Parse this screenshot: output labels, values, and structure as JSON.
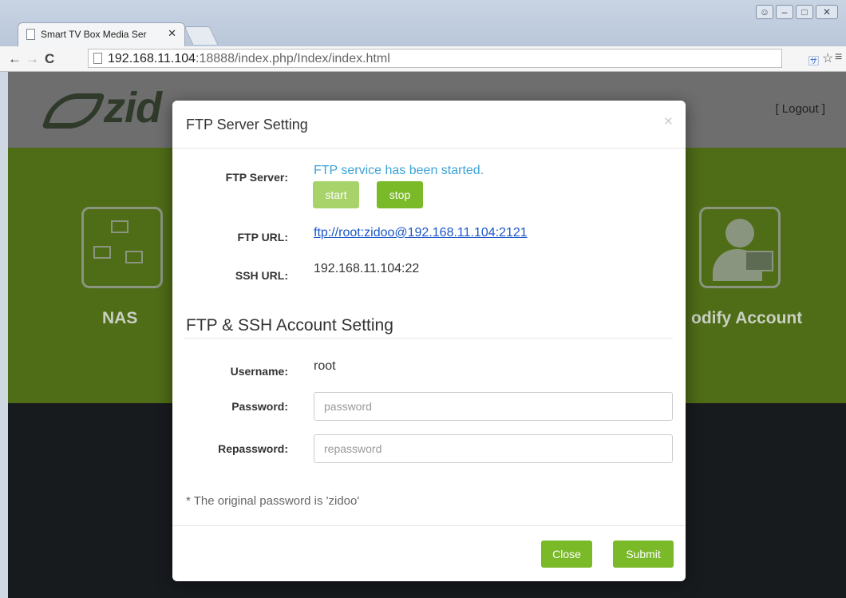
{
  "browser": {
    "tab_title": "Smart TV Box Media Ser",
    "url_host": "192.168.11.104",
    "url_rest": ":18888/index.php/Index/index.html"
  },
  "page": {
    "logo_text": "zid",
    "logout_label": "[ Logout ]",
    "tiles": [
      {
        "label": "NAS"
      },
      {
        "label": "odify Account"
      }
    ]
  },
  "modal": {
    "title": "FTP Server Setting",
    "close_glyph": "×",
    "ftp_server_label": "FTP Server:",
    "ftp_server_status": "FTP service has been started.",
    "start_label": "start",
    "stop_label": "stop",
    "ftp_url_label": "FTP URL:",
    "ftp_url_value": "ftp://root:zidoo@192.168.11.104:2121",
    "ssh_url_label": "SSH URL:",
    "ssh_url_value": "192.168.11.104:22",
    "account_section_title": "FTP & SSH Account Setting",
    "username_label": "Username:",
    "username_value": "root",
    "password_label": "Password:",
    "password_placeholder": "password",
    "repassword_label": "Repassword:",
    "repassword_placeholder": "repassword",
    "note": "* The original password is 'zidoo'",
    "close_button": "Close",
    "submit_button": "Submit"
  }
}
